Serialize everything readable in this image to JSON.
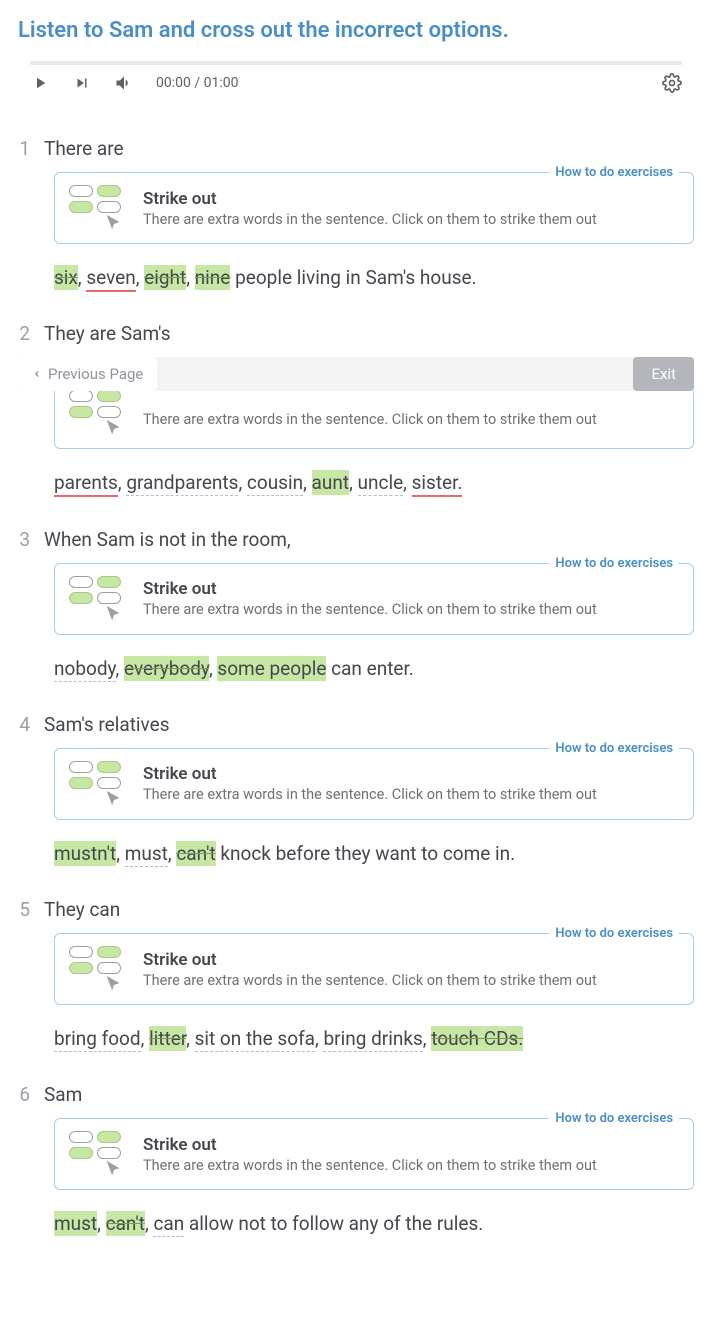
{
  "title": "Listen to Sam and cross out the incorrect options.",
  "audio": {
    "current": "00:00",
    "total": "01:00"
  },
  "nav": {
    "prev": "Previous Page",
    "exit": "Exit"
  },
  "hint": {
    "link": "How to do exercises",
    "heading": "Strike out",
    "desc": "There are extra words in the sentence. Click on them to strike them out"
  },
  "items": [
    {
      "num": "1",
      "lead": "There are",
      "tokens": [
        {
          "text": "six",
          "cls": "struck"
        },
        {
          "text": ", ",
          "sep": true
        },
        {
          "text": "seven",
          "cls": "wrong"
        },
        {
          "text": ", ",
          "sep": true
        },
        {
          "text": "eight",
          "cls": "struck"
        },
        {
          "text": ", ",
          "sep": true
        },
        {
          "text": "nine",
          "cls": "struck"
        },
        {
          "text": "  people living in Sam's house.",
          "sep": true
        }
      ],
      "fullHint": true
    },
    {
      "num": "2",
      "lead": "They are Sam's",
      "tokens": [
        {
          "text": "parents",
          "cls": "wrong"
        },
        {
          "text": ", ",
          "sep": true
        },
        {
          "text": "grandparents",
          "cls": "dash"
        },
        {
          "text": ", ",
          "sep": true
        },
        {
          "text": "cousin",
          "cls": "dash"
        },
        {
          "text": ", ",
          "sep": true
        },
        {
          "text": "aunt",
          "cls": "hl-green"
        },
        {
          "text": ", ",
          "sep": true
        },
        {
          "text": "uncle",
          "cls": "dash"
        },
        {
          "text": ", ",
          "sep": true
        },
        {
          "text": "sister.",
          "cls": "wrong"
        }
      ],
      "partialHint": true
    },
    {
      "num": "3",
      "lead": "When Sam is not in the room,",
      "tokens": [
        {
          "text": "nobody",
          "cls": "dash"
        },
        {
          "text": ", ",
          "sep": true
        },
        {
          "text": "everybody",
          "cls": "struck"
        },
        {
          "text": ", ",
          "sep": true
        },
        {
          "text": "some people",
          "cls": "hl-green"
        },
        {
          "text": "  can enter.",
          "sep": true
        }
      ],
      "fullHint": true
    },
    {
      "num": "4",
      "lead": "Sam's relatives",
      "tokens": [
        {
          "text": "mustn't",
          "cls": "hl-green"
        },
        {
          "text": ", ",
          "sep": true
        },
        {
          "text": "must",
          "cls": "dash"
        },
        {
          "text": ", ",
          "sep": true
        },
        {
          "text": "can't",
          "cls": "struck"
        },
        {
          "text": "  knock before they want to come in.",
          "sep": true
        }
      ],
      "fullHint": true
    },
    {
      "num": "5",
      "lead": "They can",
      "tokens": [
        {
          "text": "bring food",
          "cls": "dash"
        },
        {
          "text": ", ",
          "sep": true
        },
        {
          "text": "litter",
          "cls": "struck"
        },
        {
          "text": ", ",
          "sep": true
        },
        {
          "text": "sit on the sofa",
          "cls": "dash"
        },
        {
          "text": ", ",
          "sep": true
        },
        {
          "text": "bring drinks",
          "cls": "dash"
        },
        {
          "text": ", ",
          "sep": true
        },
        {
          "text": "touch CDs.",
          "cls": "struck"
        }
      ],
      "fullHint": true
    },
    {
      "num": "6",
      "lead": "Sam",
      "tokens": [
        {
          "text": "must",
          "cls": "hl-green"
        },
        {
          "text": ", ",
          "sep": true
        },
        {
          "text": "can't",
          "cls": "struck"
        },
        {
          "text": ", ",
          "sep": true
        },
        {
          "text": "can",
          "cls": "dash"
        },
        {
          "text": "  allow not to follow any of the rules.",
          "sep": true
        }
      ],
      "fullHint": true
    }
  ]
}
